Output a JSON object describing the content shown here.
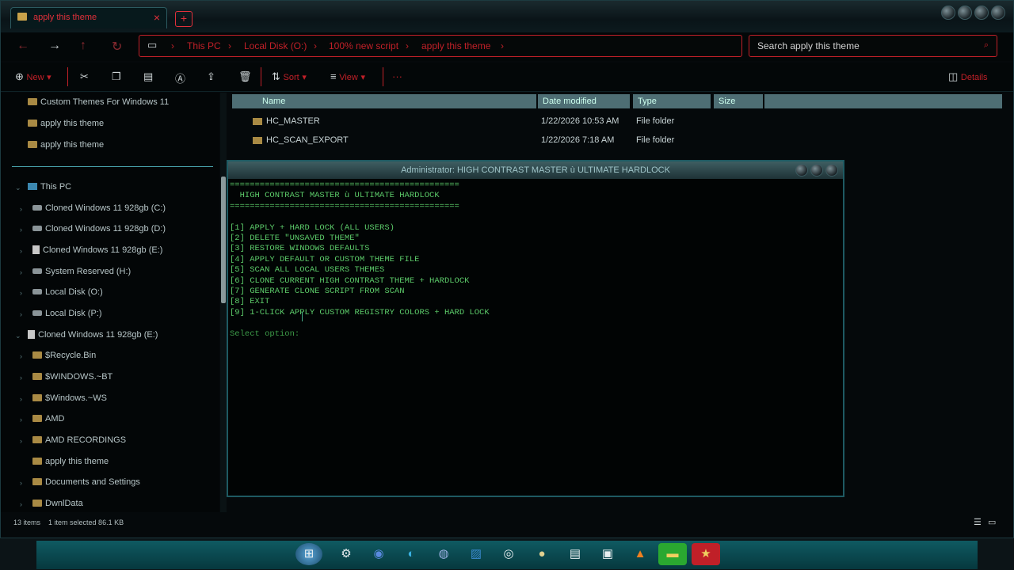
{
  "window": {
    "tab_title": "apply this theme",
    "tab_close": "×",
    "new_tab": "+"
  },
  "address": {
    "crumbs": [
      "This PC",
      "Local Disk (O:)",
      "100% new script",
      "apply this theme"
    ],
    "search_placeholder": "Search apply this theme"
  },
  "toolbar": {
    "new_label": "New",
    "sort_label": "Sort",
    "view_label": "View",
    "more_label": "···",
    "details_label": "Details"
  },
  "sidebar": {
    "top_items": [
      "Custom Themes For Windows 11",
      "apply this theme",
      "apply this theme"
    ],
    "this_pc": "This PC",
    "drives": [
      "Cloned Windows 11 928gb (C:)",
      "Cloned Windows 11 928gb (D:)",
      "Cloned Windows 11 928gb (E:)",
      "System Reserved (H:)",
      "Local Disk (O:)",
      "Local Disk (P:)"
    ],
    "expanded_drive": "Cloned Windows 11 928gb (E:)",
    "children": [
      "$Recycle.Bin",
      "$WINDOWS.~BT",
      "$Windows.~WS",
      "AMD",
      "AMD RECORDINGS",
      "apply this theme",
      "Documents and Settings",
      "DwnlData"
    ]
  },
  "file_list": {
    "headers": [
      "Name",
      "Date modified",
      "Type",
      "Size"
    ],
    "rows": [
      {
        "name": "HC_MASTER",
        "date": "1/22/2026 10:53 AM",
        "type": "File folder"
      },
      {
        "name": "HC_SCAN_EXPORT",
        "date": "1/22/2026 7:18 AM",
        "type": "File folder"
      }
    ]
  },
  "status": {
    "items": "13 items",
    "selected": "1 item selected  86.1 KB"
  },
  "console": {
    "title": "Administrator:  HIGH CONTRAST MASTER ù ULTIMATE HARDLOCK",
    "rule": "==============================================",
    "heading": "  HIGH CONTRAST MASTER ù ULTIMATE HARDLOCK",
    "options": [
      "[1] APPLY + HARD LOCK (ALL USERS)",
      "[2] DELETE \"UNSAVED THEME\"",
      "[3] RESTORE WINDOWS DEFAULTS",
      "[4] APPLY DEFAULT OR CUSTOM THEME FILE",
      "[5] SCAN ALL LOCAL USERS THEMES",
      "[6] CLONE CURRENT HIGH CONTRAST THEME + HARDLOCK",
      "[7] GENERATE CLONE SCRIPT FROM SCAN",
      "[8] EXIT",
      "[9] 1-CLICK APPLY CUSTOM REGISTRY COLORS + HARD LOCK"
    ],
    "prompt": "Select option: "
  },
  "taskbar": {
    "icons": [
      "start-icon",
      "settings-icon",
      "firefox-icon",
      "edge-icon",
      "chat-icon",
      "photos-icon",
      "obs-icon",
      "disc-icon",
      "notepad-icon",
      "app-icon",
      "vlc-icon",
      "explorer-icon",
      "star-icon"
    ]
  }
}
